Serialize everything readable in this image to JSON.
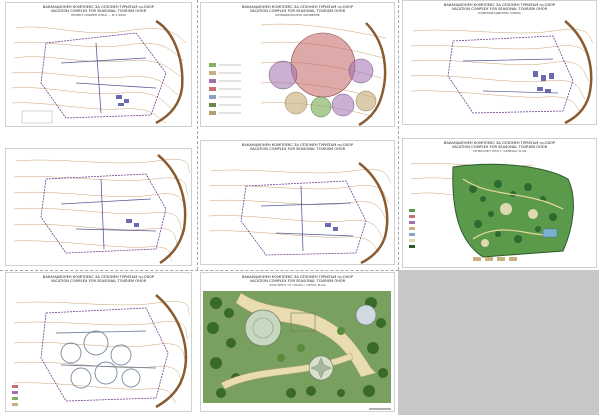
{
  "title_bg": "ВАКАНЦИОНЕН КОМПЛЕКС ЗА СЕЗОНЕН ТУРИЗЪМ гр.ОХОР",
  "title_en": "VACATION COMPLEX FOR SEASONAL TOURISM OHOR",
  "panel_a_sub": "ПРОЕКТ ОПОРЕН ПЛАН — М 1:5000",
  "panel_b_sub": "ФУНКЦИОНАЛНО ЗОНИРАНЕ",
  "panel_c_sub": "КОМУНИКАЦИОННА СХЕМА",
  "panel_f_sub": "ГЕНЕРАЛЕН ПЛАН / GENERAL PLAN",
  "panel_h_sub": "ФРАГМЕНТ ОТ ПЛАНА / DETAIL PLAN",
  "colors": {
    "terrain": "#c8a070",
    "coast": "#8a5a30",
    "boundary": "#704090",
    "road": "#5a5a9a",
    "green": "#3a8a3a",
    "dark_green": "#2d5a2d",
    "zone_red": "#c87070",
    "zone_purple": "#a070b0",
    "zone_green": "#80b060",
    "zone_tan": "#c8b080",
    "gray_block": "#c8c8c8"
  }
}
